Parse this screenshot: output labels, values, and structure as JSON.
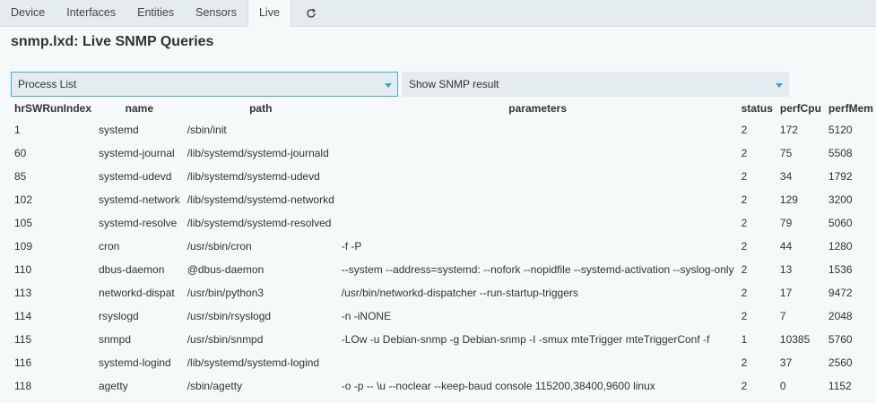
{
  "tabs": [
    {
      "label": "Device"
    },
    {
      "label": "Interfaces"
    },
    {
      "label": "Entities"
    },
    {
      "label": "Sensors"
    },
    {
      "label": "Live"
    }
  ],
  "refresh_icon": "refresh-icon",
  "page_title": "snmp.lxd: Live SNMP Queries",
  "query_select": {
    "value": "Process List"
  },
  "result_select": {
    "value": "Show SNMP result"
  },
  "table": {
    "headers": [
      "hrSWRunIndex",
      "name",
      "path",
      "parameters",
      "status",
      "perfCpu",
      "perfMem"
    ],
    "rows": [
      [
        "1",
        "systemd",
        "/sbin/init",
        "",
        "2",
        "172",
        "5120"
      ],
      [
        "60",
        "systemd-journal",
        "/lib/systemd/systemd-journald",
        "",
        "2",
        "75",
        "5508"
      ],
      [
        "85",
        "systemd-udevd",
        "/lib/systemd/systemd-udevd",
        "",
        "2",
        "34",
        "1792"
      ],
      [
        "102",
        "systemd-network",
        "/lib/systemd/systemd-networkd",
        "",
        "2",
        "129",
        "3200"
      ],
      [
        "105",
        "systemd-resolve",
        "/lib/systemd/systemd-resolved",
        "",
        "2",
        "79",
        "5060"
      ],
      [
        "109",
        "cron",
        "/usr/sbin/cron",
        "-f -P",
        "2",
        "44",
        "1280"
      ],
      [
        "110",
        "dbus-daemon",
        "@dbus-daemon",
        "--system --address=systemd: --nofork --nopidfile --systemd-activation --syslog-only",
        "2",
        "13",
        "1536"
      ],
      [
        "113",
        "networkd-dispat",
        "/usr/bin/python3",
        "/usr/bin/networkd-dispatcher --run-startup-triggers",
        "2",
        "17",
        "9472"
      ],
      [
        "114",
        "rsyslogd",
        "/usr/sbin/rsyslogd",
        "-n -iNONE",
        "2",
        "7",
        "2048"
      ],
      [
        "115",
        "snmpd",
        "/usr/sbin/snmpd",
        "-LOw -u Debian-snmp -g Debian-snmp -I -smux mteTrigger mteTriggerConf -f",
        "1",
        "10385",
        "5760"
      ],
      [
        "116",
        "systemd-logind",
        "/lib/systemd/systemd-logind",
        "",
        "2",
        "37",
        "2560"
      ],
      [
        "118",
        "agetty",
        "/sbin/agetty",
        "-o -p -- \\u --noclear --keep-baud console 115200,38400,9600 linux",
        "2",
        "0",
        "1152"
      ]
    ]
  }
}
